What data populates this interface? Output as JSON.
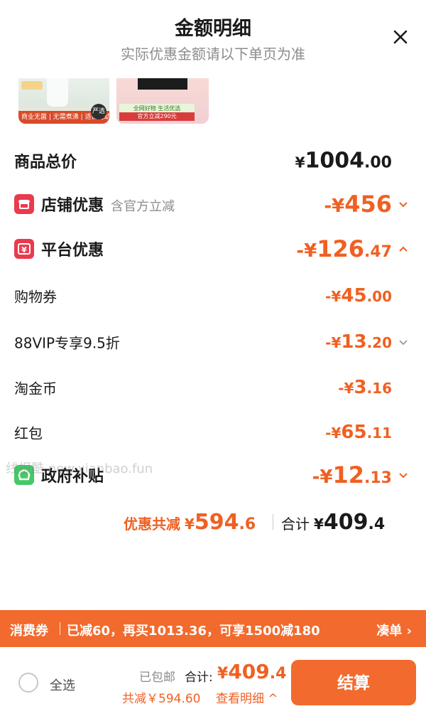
{
  "header": {
    "title": "金额明细",
    "subtitle": "实际优惠金额请以下单页为准"
  },
  "thumbnails": {
    "item1_strip": "商业无菌 | 无需煮沸 | 适合婴幼",
    "item1_tag": "严选",
    "item2_banner": "全网好物 生活优选",
    "item2_strip": "官方立减290元"
  },
  "rows": {
    "total": {
      "label": "商品总价",
      "currency": "¥",
      "int": "1004",
      "dec": ".00"
    },
    "store": {
      "label": "店铺优惠",
      "sublabel": "含官方立减",
      "currency": "-¥",
      "int": "456",
      "dec": ""
    },
    "platform": {
      "label": "平台优惠",
      "currency": "-¥",
      "int": "126",
      "dec": ".47"
    },
    "coupon": {
      "label": "购物券",
      "currency": "-¥",
      "int": "45",
      "dec": ".00"
    },
    "vip": {
      "label": "88VIP专享9.5折",
      "currency": "-¥",
      "int": "13",
      "dec": ".20"
    },
    "gold": {
      "label": "淘金币",
      "currency": "-¥",
      "int": "3",
      "dec": ".16"
    },
    "redpacket": {
      "label": "红包",
      "currency": "-¥",
      "int": "65",
      "dec": ".11"
    },
    "gov": {
      "label": "政府补贴",
      "currency": "-¥",
      "int": "12",
      "dec": ".13"
    }
  },
  "watermark": "线报酷 new.xianbao.fun",
  "summary": {
    "discount_label": "优惠共减",
    "discount_currency": "¥",
    "discount_int": "594",
    "discount_dec": ".6",
    "total_label": "合计",
    "total_currency": "¥",
    "total_int": "409",
    "total_dec": ".4"
  },
  "coupon_bar": {
    "tag": "消费券",
    "message": "已减60，再买1013.36，可享1500减180",
    "cta": "凑单 ›"
  },
  "footer": {
    "select_all": "全选",
    "shipping": "已包邮",
    "total_label": "合计:",
    "total_currency": "¥",
    "total_int": "409",
    "total_dec": ".4",
    "savings": "共减￥594.60",
    "detail": "查看明细 ^",
    "checkout": "结算"
  },
  "colors": {
    "accent": "#f26a2d",
    "price_orange": "#f06022",
    "badge_red": "#ea3a4e",
    "badge_green": "#44c968"
  },
  "icons": {
    "close": "close-icon",
    "store": "store-icon",
    "platform": "yen-coupon-icon",
    "gov": "gov-subsidy-icon",
    "chevron_down": "chevron-down-icon",
    "chevron_up": "chevron-up-icon"
  }
}
